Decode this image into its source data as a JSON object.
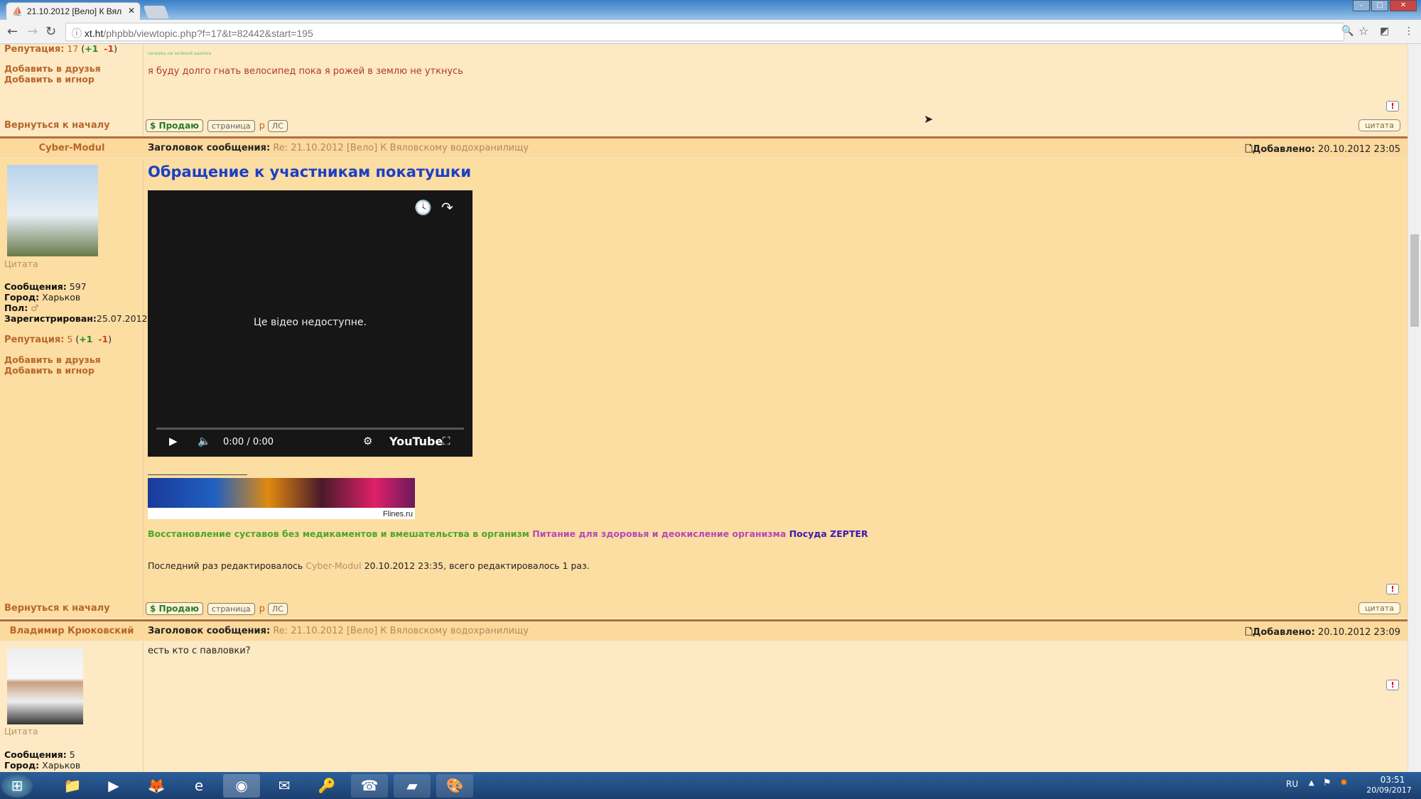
{
  "browser": {
    "tab_title": "21.10.2012 [Вело] К Вял",
    "url_host": "xt.ht",
    "url_path": "/phpbb/viewtopic.php?f=17&t=82442&start=195"
  },
  "common": {
    "back_to_top": "Вернуться к началу",
    "btn_sell": "$ Продаю",
    "btn_page": "страница",
    "btn_p": "р",
    "btn_pm": "ЛС",
    "btn_quote": "цитата",
    "add_friend": "Добавить в друзья",
    "add_ignore": "Добавить в игнор",
    "subject_label": "Заголовок сообщения:",
    "added_label": "Добавлено:",
    "quote_label": "Цитата",
    "rep_label": "Репутация:",
    "plus": "+1",
    "minus": "-1",
    "posts_label": "Сообщения:",
    "city_label": "Город:",
    "sex_label": "Пол:",
    "reg_label": "Зарегистрирован:"
  },
  "prev_post": {
    "reputation": "17",
    "small_sig": "начнись на зеленой ашипке",
    "signature": "я буду долго гнать велосипед пока я рожей в землю не уткнусь"
  },
  "post1": {
    "author": "Cyber-Modul",
    "subject": "Re: 21.10.2012 [Вело] К Вяловскому водохранилищу",
    "date": "20.10.2012 23:05",
    "title": "Обращение к участникам покатушки",
    "video_message": "Це відео недоступне.",
    "video_time": "0:00 / 0:00",
    "video_brand": "YouTube",
    "posts": "597",
    "city": "Харьков",
    "sex": "♂",
    "registered": "25.07.2012",
    "reputation": "5",
    "banner_text": "Flines.ru",
    "link1": "Восстановление суставов без медикаментов и вмешательства в организм",
    "link2": "Питание для здоровья и деокисление организма",
    "link3": "Посуда ZEPTER",
    "edit_prefix": "Последний раз редактировалось",
    "edit_user": "Cyber-Modul",
    "edit_suffix": "20.10.2012 23:35, всего редактировалось 1 раз."
  },
  "post2": {
    "author": "Владимир Крюковский",
    "subject": "Re: 21.10.2012 [Вело] К Вяловскому водохранилищу",
    "date": "20.10.2012 23:09",
    "text": "есть кто с павловки?",
    "posts": "5",
    "city": "Харьков"
  },
  "taskbar": {
    "lang": "RU",
    "time": "03:51",
    "date": "20/09/2017"
  }
}
